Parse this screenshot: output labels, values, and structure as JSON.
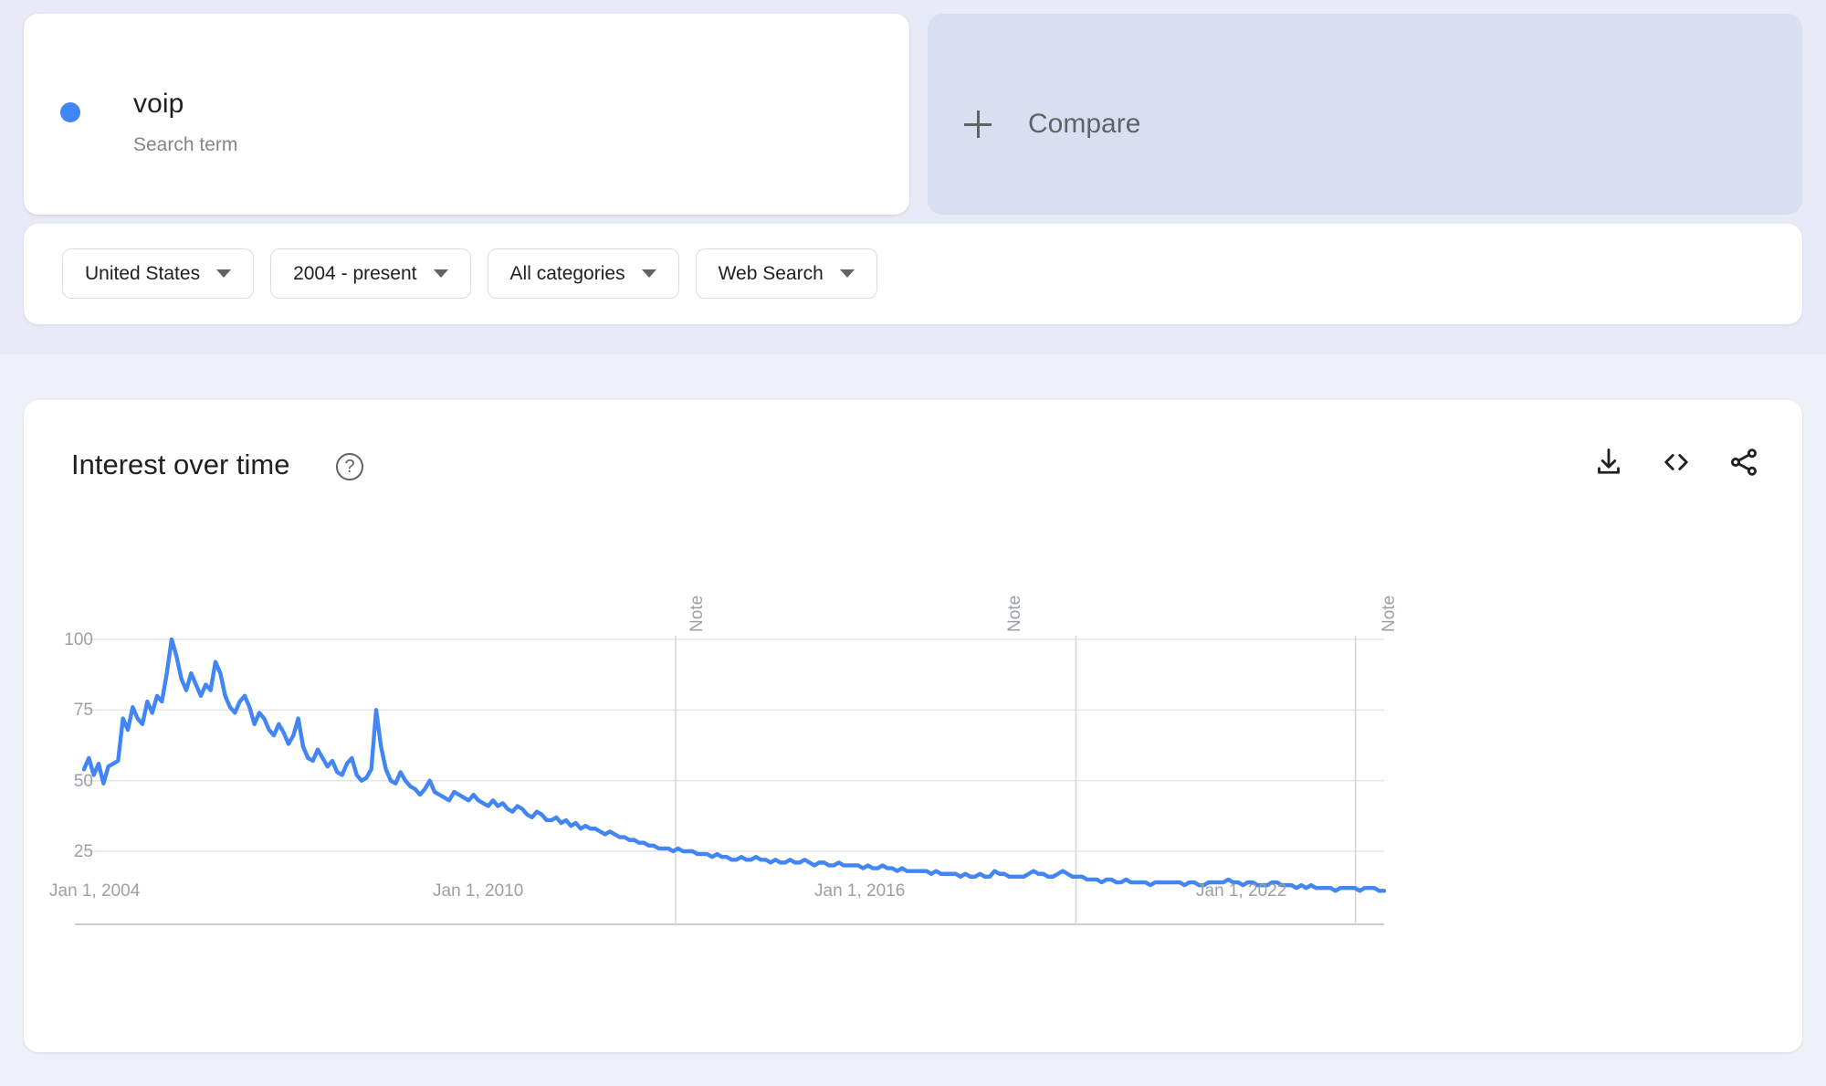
{
  "search_term": {
    "name": "voip",
    "type_label": "Search term",
    "dot_color": "#4285f4"
  },
  "compare": {
    "label": "Compare",
    "icon": "plus-icon"
  },
  "filters": [
    {
      "label": "United States",
      "icon": "chevron-down-icon"
    },
    {
      "label": "2004 - present",
      "icon": "chevron-down-icon"
    },
    {
      "label": "All categories",
      "icon": "chevron-down-icon"
    },
    {
      "label": "Web Search",
      "icon": "chevron-down-icon"
    }
  ],
  "chart_card": {
    "title": "Interest over time",
    "help_icon": "help-circle-icon",
    "help_glyph": "?",
    "actions": [
      {
        "name": "download-icon"
      },
      {
        "name": "embed-code-icon"
      },
      {
        "name": "share-icon"
      }
    ]
  },
  "chart_data": {
    "type": "line",
    "title": "Interest over time",
    "xlabel": "",
    "ylabel": "",
    "ylim": [
      0,
      100
    ],
    "yticks": [
      100,
      75,
      50,
      25
    ],
    "xticks": [
      "Jan 1, 2004",
      "Jan 1, 2010",
      "Jan 1, 2016",
      "Jan 1, 2022"
    ],
    "grid": true,
    "legend_position": "none",
    "annotations": [
      {
        "label": "Note",
        "at_fraction": 0.455
      },
      {
        "label": "Note",
        "at_fraction": 0.763
      },
      {
        "label": "Note",
        "at_fraction": 0.978
      }
    ],
    "series": [
      {
        "name": "voip",
        "color": "#4285f4",
        "x_start": "Jan 1, 2004",
        "x_end": "present",
        "values": [
          54,
          58,
          52,
          56,
          49,
          55,
          56,
          57,
          72,
          68,
          76,
          72,
          70,
          78,
          74,
          80,
          78,
          88,
          100,
          94,
          86,
          82,
          88,
          84,
          80,
          84,
          82,
          92,
          88,
          80,
          76,
          74,
          78,
          80,
          76,
          70,
          74,
          72,
          68,
          66,
          70,
          67,
          63,
          66,
          72,
          62,
          58,
          57,
          61,
          58,
          55,
          57,
          53,
          52,
          56,
          58,
          52,
          50,
          51,
          54,
          75,
          62,
          54,
          50,
          49,
          53,
          50,
          48,
          47,
          45,
          47,
          50,
          46,
          45,
          44,
          43,
          46,
          45,
          44,
          43,
          45,
          43,
          42,
          41,
          43,
          41,
          42,
          40,
          39,
          41,
          40,
          38,
          37,
          39,
          38,
          36,
          36,
          37,
          35,
          36,
          34,
          35,
          33,
          34,
          33,
          33,
          32,
          31,
          32,
          31,
          30,
          30,
          29,
          29,
          28,
          28,
          27,
          27,
          26,
          26,
          26,
          25,
          26,
          25,
          25,
          25,
          24,
          24,
          24,
          23,
          24,
          23,
          23,
          22,
          22,
          23,
          22,
          22,
          23,
          22,
          22,
          21,
          22,
          21,
          21,
          22,
          21,
          21,
          22,
          21,
          20,
          21,
          21,
          20,
          20,
          21,
          20,
          20,
          20,
          20,
          19,
          20,
          19,
          19,
          20,
          19,
          19,
          18,
          19,
          18,
          18,
          18,
          18,
          18,
          17,
          18,
          17,
          17,
          17,
          17,
          16,
          17,
          16,
          16,
          17,
          16,
          16,
          18,
          17,
          17,
          16,
          16,
          16,
          16,
          17,
          18,
          17,
          17,
          16,
          16,
          17,
          18,
          17,
          16,
          16,
          16,
          15,
          15,
          15,
          14,
          15,
          15,
          14,
          14,
          15,
          14,
          14,
          14,
          14,
          13,
          14,
          14,
          14,
          14,
          14,
          14,
          13,
          14,
          14,
          13,
          13,
          14,
          14,
          14,
          14,
          15,
          14,
          14,
          13,
          14,
          14,
          13,
          13,
          13,
          14,
          14,
          13,
          13,
          13,
          12,
          13,
          12,
          13,
          12,
          12,
          12,
          12,
          11,
          12,
          12,
          12,
          12,
          11,
          12,
          12,
          12,
          11,
          11
        ]
      }
    ]
  }
}
